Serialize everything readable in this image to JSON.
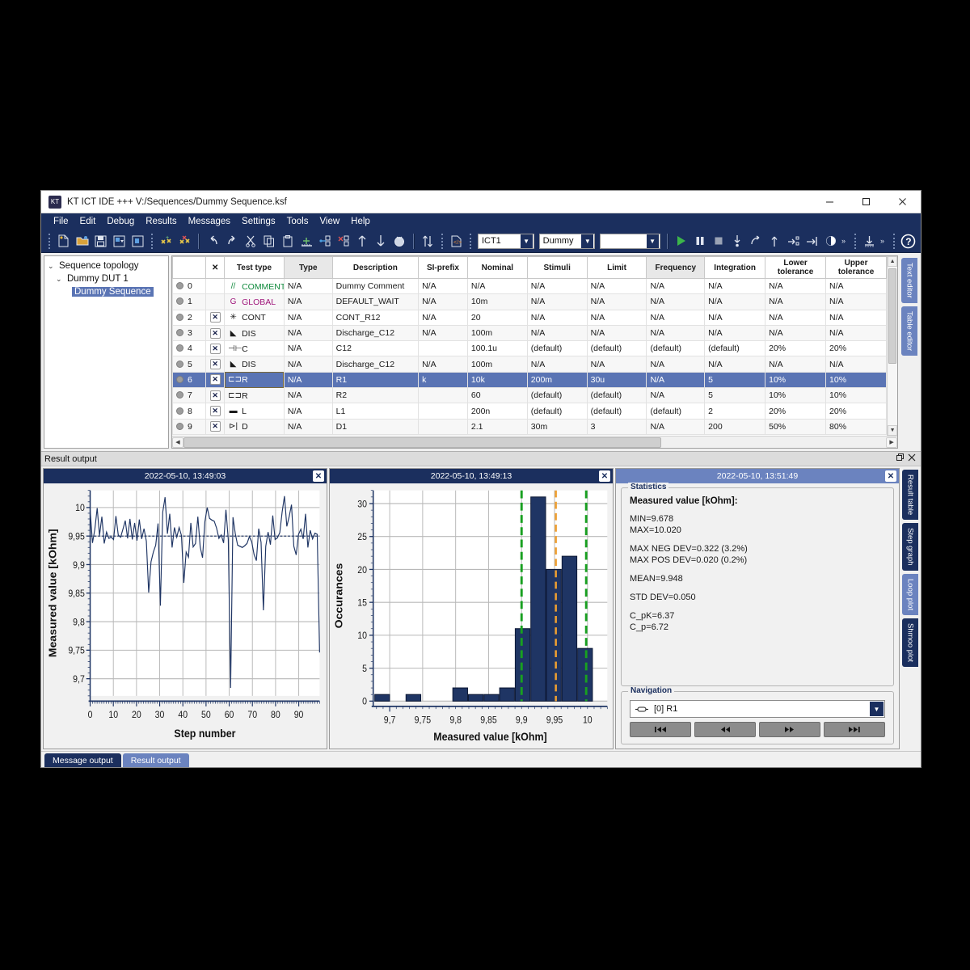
{
  "window": {
    "title": "KT ICT IDE +++ V:/Sequences/Dummy Sequence.ksf",
    "minimize": "–",
    "maximize": "□",
    "close": "✕"
  },
  "menu": [
    "File",
    "Edit",
    "Debug",
    "Results",
    "Messages",
    "Settings",
    "Tools",
    "View",
    "Help"
  ],
  "toolbar": {
    "combo_station": "ICT1",
    "combo_dut": "Dummy",
    "combo_empty": "",
    "icons": [
      "new-file-icon",
      "open-folder-icon",
      "save-icon",
      "save-as-icon",
      "save-all-icon",
      "add-step-icon",
      "remove-step-icon",
      "undo-icon",
      "redo-icon",
      "cut-icon",
      "copy-icon",
      "paste-icon",
      "insert-row-icon",
      "link-icon",
      "unlink-icon",
      "move-up-icon",
      "move-down-icon",
      "clear-icon",
      "sort-icon",
      "script-icon",
      "run-icon",
      "pause-icon",
      "stop-icon",
      "step-into-icon",
      "step-over-icon",
      "step-out-icon",
      "run-to-icon",
      "goto-icon",
      "breakpoint-icon",
      "overflow-icon",
      "download-icon",
      "overflow2-icon",
      "help-icon"
    ]
  },
  "sidebar": {
    "root": "Sequence topology",
    "dut": "Dummy DUT 1",
    "sequence": "Dummy Sequence"
  },
  "editor_tabs": [
    {
      "label": "Text editor",
      "active": true
    },
    {
      "label": "Table editor",
      "active": false
    }
  ],
  "table": {
    "headers": [
      "",
      "✕",
      "Test type",
      "Type",
      "Description",
      "SI-prefix",
      "Nominal",
      "Stimuli",
      "Limit",
      "Frequency",
      "Integration",
      "Lower tolerance",
      "Upper tolerance"
    ],
    "rows": [
      {
        "idx": "0",
        "x": "",
        "glyph": "//",
        "test": "COMMENT",
        "type": "N/A",
        "desc": "Dummy Comment",
        "si": "N/A",
        "nom": "N/A",
        "stim": "N/A",
        "lim": "N/A",
        "freq": "N/A",
        "integ": "N/A",
        "lo": "N/A",
        "up": "N/A",
        "color": "green"
      },
      {
        "idx": "1",
        "x": "",
        "glyph": "G",
        "test": "GLOBAL",
        "type": "N/A",
        "desc": "DEFAULT_WAIT",
        "si": "N/A",
        "nom": "10m",
        "stim": "N/A",
        "lim": "N/A",
        "freq": "N/A",
        "integ": "N/A",
        "lo": "N/A",
        "up": "N/A",
        "color": "purple"
      },
      {
        "idx": "2",
        "x": "✕",
        "glyph": "✳",
        "test": "CONT",
        "type": "N/A",
        "desc": "CONT_R12",
        "si": "N/A",
        "nom": "20",
        "stim": "N/A",
        "lim": "N/A",
        "freq": "N/A",
        "integ": "N/A",
        "lo": "N/A",
        "up": "N/A",
        "color": "black"
      },
      {
        "idx": "3",
        "x": "✕",
        "glyph": "◣",
        "test": "DIS",
        "type": "N/A",
        "desc": "Discharge_C12",
        "si": "N/A",
        "nom": "100m",
        "stim": "N/A",
        "lim": "N/A",
        "freq": "N/A",
        "integ": "N/A",
        "lo": "N/A",
        "up": "N/A",
        "color": "black"
      },
      {
        "idx": "4",
        "x": "✕",
        "glyph": "⊣⊢",
        "test": "C",
        "type": "N/A",
        "desc": "C12",
        "si": "",
        "nom": "100.1u",
        "stim": "(default)",
        "lim": "(default)",
        "freq": "(default)",
        "integ": "(default)",
        "lo": "20%",
        "up": "20%",
        "color": "black"
      },
      {
        "idx": "5",
        "x": "✕",
        "glyph": "◣",
        "test": "DIS",
        "type": "N/A",
        "desc": "Discharge_C12",
        "si": "N/A",
        "nom": "100m",
        "stim": "N/A",
        "lim": "N/A",
        "freq": "N/A",
        "integ": "N/A",
        "lo": "N/A",
        "up": "N/A",
        "color": "black"
      },
      {
        "idx": "6",
        "x": "✕",
        "glyph": "⊏⊐",
        "test": "R",
        "type": "N/A",
        "desc": "R1",
        "si": "k",
        "nom": "10k",
        "stim": "200m",
        "lim": "30u",
        "freq": "N/A",
        "integ": "5",
        "lo": "10%",
        "up": "10%",
        "color": "black",
        "selected": true
      },
      {
        "idx": "7",
        "x": "✕",
        "glyph": "⊏⊐",
        "test": "R",
        "type": "N/A",
        "desc": "R2",
        "si": "",
        "nom": "60",
        "stim": "(default)",
        "lim": "(default)",
        "freq": "N/A",
        "integ": "5",
        "lo": "10%",
        "up": "10%",
        "color": "black"
      },
      {
        "idx": "8",
        "x": "✕",
        "glyph": "▬",
        "test": "L",
        "type": "N/A",
        "desc": "L1",
        "si": "",
        "nom": "200n",
        "stim": "(default)",
        "lim": "(default)",
        "freq": "(default)",
        "integ": "2",
        "lo": "20%",
        "up": "20%",
        "color": "black"
      },
      {
        "idx": "9",
        "x": "✕",
        "glyph": "⊳|",
        "test": "D",
        "type": "N/A",
        "desc": "D1",
        "si": "",
        "nom": "2.1",
        "stim": "30m",
        "lim": "3",
        "freq": "N/A",
        "integ": "200",
        "lo": "50%",
        "up": "80%",
        "color": "black"
      }
    ]
  },
  "dock": {
    "caption": "Result output",
    "float_icon": "restore-icon",
    "close_icon": "close-icon"
  },
  "panes": [
    {
      "title": "2022-05-10, 13:49:03",
      "active": true
    },
    {
      "title": "2022-05-10, 13:49:13",
      "active": true
    },
    {
      "title": "2022-05-10, 13:51:49",
      "active": false
    }
  ],
  "statistics": {
    "group_label": "Statistics",
    "title": "Measured value [kOhm]:",
    "lines": [
      "MIN=9.678",
      "MAX=10.020",
      "",
      "MAX NEG DEV=0.322 (3.2%)",
      "MAX POS DEV=0.020 (0.2%)",
      "",
      "MEAN=9.948",
      "",
      "STD DEV=0.050",
      "",
      "C_pK=6.37",
      "C_p=6.72"
    ]
  },
  "navigation": {
    "group_label": "Navigation",
    "selected": "[0] R1",
    "buttons": [
      "|◀◀",
      "◀◀",
      "▶▶",
      "▶▶|"
    ]
  },
  "result_tabs": [
    {
      "label": "Result table",
      "active": false
    },
    {
      "label": "Step graph",
      "active": false
    },
    {
      "label": "Loop plot",
      "active": true
    },
    {
      "label": "Shmoo plot",
      "active": false
    }
  ],
  "bottom_tabs": [
    {
      "label": "Message output",
      "active": false
    },
    {
      "label": "Result output",
      "active": true
    }
  ],
  "colors": {
    "accent": "#1b2f5e",
    "accent_light": "#6b83bf",
    "selection": "#5a74b4",
    "series": "#1f3564",
    "limit_line": "#18a020",
    "nominal_line": "#f0a030",
    "green_text": "#0f8a3c",
    "purple_text": "#a0187c"
  },
  "chart_data": [
    {
      "type": "line",
      "title": "",
      "xlabel": "Step number",
      "ylabel": "Measured value [kOhm]",
      "xlim": [
        0,
        99
      ],
      "ylim": [
        9.67,
        10.03
      ],
      "xticks": [
        "0",
        "10",
        "20",
        "30",
        "40",
        "50",
        "60",
        "70",
        "80",
        "90"
      ],
      "yticks": [
        "9,7",
        "9,75",
        "9,8",
        "9,85",
        "9,9",
        "9,95",
        "10"
      ],
      "grid": true,
      "reference_line": 9.95,
      "series": [
        {
          "name": "Measured value",
          "color": "#1f3564",
          "values": [
            9.995,
            9.938,
            9.962,
            9.999,
            9.951,
            9.984,
            9.937,
            9.957,
            9.946,
            9.948,
            9.944,
            9.985,
            9.952,
            9.948,
            9.962,
            9.977,
            9.946,
            9.98,
            9.944,
            9.973,
            9.942,
            9.979,
            9.945,
            9.963,
            9.941,
            9.851,
            9.905,
            9.922,
            9.934,
            9.972,
            9.828,
            9.992,
            10.018,
            9.954,
            9.989,
            9.93,
            9.965,
            9.948,
            9.965,
            9.951,
            9.868,
            9.922,
            9.913,
            9.973,
            9.931,
            9.937,
            9.984,
            9.931,
            9.912,
            9.975,
            10.0,
            9.981,
            9.978,
            9.976,
            9.964,
            9.946,
            9.952,
            9.938,
            9.996,
            9.944,
            9.684,
            9.983,
            9.954,
            9.934,
            9.932,
            9.93,
            9.933,
            9.937,
            9.949,
            9.94,
            9.918,
            9.907,
            9.963,
            9.939,
            9.82,
            9.932,
            9.957,
            9.935,
            9.986,
            9.944,
            9.947,
            9.956,
            9.992,
            10.02,
            9.967,
            9.984,
            10.005,
            9.932,
            9.917,
            9.953,
            9.962,
            9.945,
            9.989,
            9.93,
            9.96,
            9.945,
            9.955,
            9.953,
            9.746
          ]
        }
      ]
    },
    {
      "type": "bar",
      "title": "",
      "xlabel": "Measured value [kOhm]",
      "ylabel": "Occurances",
      "xlim": [
        9.675,
        10.03
      ],
      "ylim": [
        0,
        32
      ],
      "xticks": [
        "9,7",
        "9,75",
        "9,8",
        "9,85",
        "9,9",
        "9,95",
        "10"
      ],
      "yticks": [
        "0",
        "5",
        "10",
        "15",
        "20",
        "25",
        "30"
      ],
      "grid": true,
      "bin_centers": [
        9.685,
        9.71,
        9.735,
        9.76,
        9.785,
        9.81,
        9.835,
        9.86,
        9.885,
        9.91,
        9.935,
        9.96,
        9.985
      ],
      "values": [
        1,
        0,
        1,
        0,
        0,
        2,
        1,
        1,
        2,
        11,
        31,
        20,
        22,
        8
      ],
      "bar_color": "#1f3564",
      "lower_limit": 9.9,
      "upper_limit": 9.998,
      "nominal": 9.952,
      "limit_color": "#18a020",
      "nominal_color": "#f0a030"
    }
  ]
}
